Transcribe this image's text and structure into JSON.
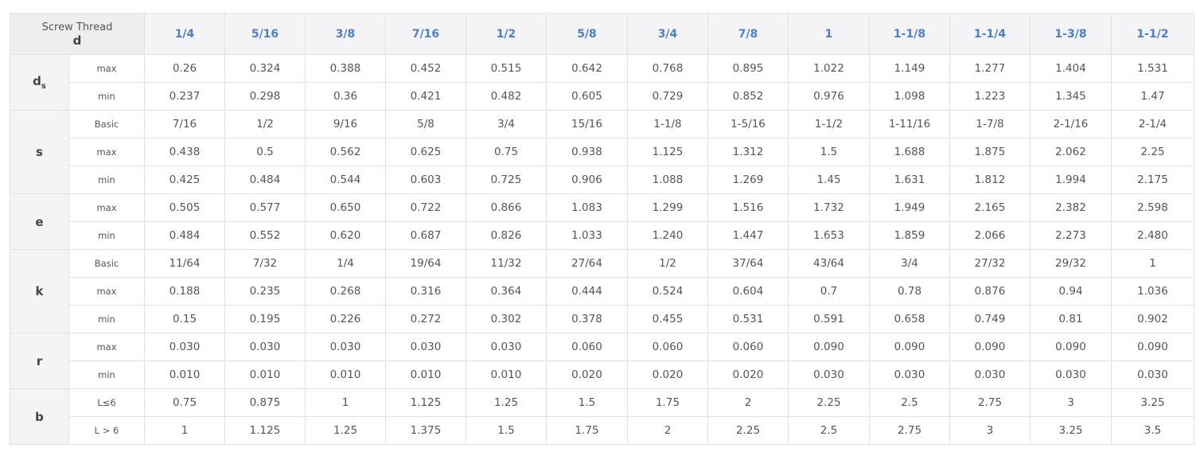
{
  "header": {
    "corner_line1": "Screw Thread",
    "corner_line2": "d",
    "columns": [
      "1/4",
      "5/16",
      "3/8",
      "7/16",
      "1/2",
      "5/8",
      "3/4",
      "7/8",
      "1",
      "1-1/8",
      "1-1/4",
      "1-3/8",
      "1-1/2"
    ]
  },
  "groups": [
    {
      "symbol": "d",
      "subscript": "s",
      "rows": [
        {
          "label": "max",
          "values": [
            "0.26",
            "0.324",
            "0.388",
            "0.452",
            "0.515",
            "0.642",
            "0.768",
            "0.895",
            "1.022",
            "1.149",
            "1.277",
            "1.404",
            "1.531"
          ]
        },
        {
          "label": "min",
          "values": [
            "0.237",
            "0.298",
            "0.36",
            "0.421",
            "0.482",
            "0.605",
            "0.729",
            "0.852",
            "0.976",
            "1.098",
            "1.223",
            "1.345",
            "1.47"
          ]
        }
      ]
    },
    {
      "symbol": "s",
      "subscript": "",
      "rows": [
        {
          "label": "Basic",
          "values": [
            "7/16",
            "1/2",
            "9/16",
            "5/8",
            "3/4",
            "15/16",
            "1-1/8",
            "1-5/16",
            "1-1/2",
            "1-11/16",
            "1-7/8",
            "2-1/16",
            "2-1/4"
          ]
        },
        {
          "label": "max",
          "values": [
            "0.438",
            "0.5",
            "0.562",
            "0.625",
            "0.75",
            "0.938",
            "1.125",
            "1.312",
            "1.5",
            "1.688",
            "1.875",
            "2.062",
            "2.25"
          ]
        },
        {
          "label": "min",
          "values": [
            "0.425",
            "0.484",
            "0.544",
            "0.603",
            "0.725",
            "0.906",
            "1.088",
            "1.269",
            "1.45",
            "1.631",
            "1.812",
            "1.994",
            "2.175"
          ]
        }
      ]
    },
    {
      "symbol": "e",
      "subscript": "",
      "rows": [
        {
          "label": "max",
          "values": [
            "0.505",
            "0.577",
            "0.650",
            "0.722",
            "0.866",
            "1.083",
            "1.299",
            "1.516",
            "1.732",
            "1.949",
            "2.165",
            "2.382",
            "2.598"
          ]
        },
        {
          "label": "min",
          "values": [
            "0.484",
            "0.552",
            "0.620",
            "0.687",
            "0.826",
            "1.033",
            "1.240",
            "1.447",
            "1.653",
            "1.859",
            "2.066",
            "2.273",
            "2.480"
          ]
        }
      ]
    },
    {
      "symbol": "k",
      "subscript": "",
      "rows": [
        {
          "label": "Basic",
          "values": [
            "11/64",
            "7/32",
            "1/4",
            "19/64",
            "11/32",
            "27/64",
            "1/2",
            "37/64",
            "43/64",
            "3/4",
            "27/32",
            "29/32",
            "1"
          ]
        },
        {
          "label": "max",
          "values": [
            "0.188",
            "0.235",
            "0.268",
            "0.316",
            "0.364",
            "0.444",
            "0.524",
            "0.604",
            "0.7",
            "0.78",
            "0.876",
            "0.94",
            "1.036"
          ]
        },
        {
          "label": "min",
          "values": [
            "0.15",
            "0.195",
            "0.226",
            "0.272",
            "0.302",
            "0.378",
            "0.455",
            "0.531",
            "0.591",
            "0.658",
            "0.749",
            "0.81",
            "0.902"
          ]
        }
      ]
    },
    {
      "symbol": "r",
      "subscript": "",
      "rows": [
        {
          "label": "max",
          "values": [
            "0.030",
            "0.030",
            "0.030",
            "0.030",
            "0.030",
            "0.060",
            "0.060",
            "0.060",
            "0.090",
            "0.090",
            "0.090",
            "0.090",
            "0.090"
          ]
        },
        {
          "label": "min",
          "values": [
            "0.010",
            "0.010",
            "0.010",
            "0.010",
            "0.010",
            "0.020",
            "0.020",
            "0.020",
            "0.030",
            "0.030",
            "0.030",
            "0.030",
            "0.030"
          ]
        }
      ]
    },
    {
      "symbol": "b",
      "subscript": "",
      "rows": [
        {
          "label": "L≤6",
          "values": [
            "0.75",
            "0.875",
            "1",
            "1.125",
            "1.25",
            "1.5",
            "1.75",
            "2",
            "2.25",
            "2.5",
            "2.75",
            "3",
            "3.25"
          ]
        },
        {
          "label": "L > 6",
          "values": [
            "1",
            "1.125",
            "1.25",
            "1.375",
            "1.5",
            "1.75",
            "2",
            "2.25",
            "2.5",
            "2.75",
            "3",
            "3.25",
            "3.5"
          ]
        }
      ]
    }
  ]
}
